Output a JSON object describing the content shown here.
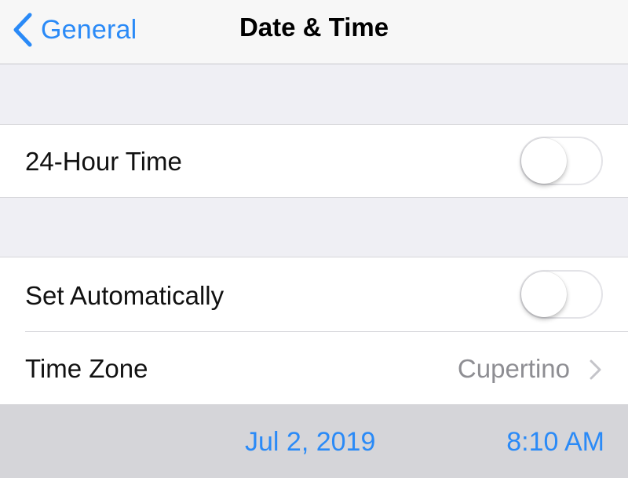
{
  "navbar": {
    "back_label": "General",
    "title": "Date & Time"
  },
  "settings": {
    "hour24": {
      "label": "24-Hour Time",
      "enabled": false
    },
    "set_automatically": {
      "label": "Set Automatically",
      "enabled": false
    },
    "time_zone": {
      "label": "Time Zone",
      "value": "Cupertino"
    }
  },
  "picker": {
    "date": "Jul 2, 2019",
    "time": "8:10 AM"
  },
  "colors": {
    "accent": "#2a8af7",
    "background": "#efeff4",
    "picker_background": "#d5d5d9",
    "secondary_text": "#8e8e93"
  },
  "icons": {
    "back": "chevron-left-icon",
    "disclosure": "chevron-right-icon"
  }
}
